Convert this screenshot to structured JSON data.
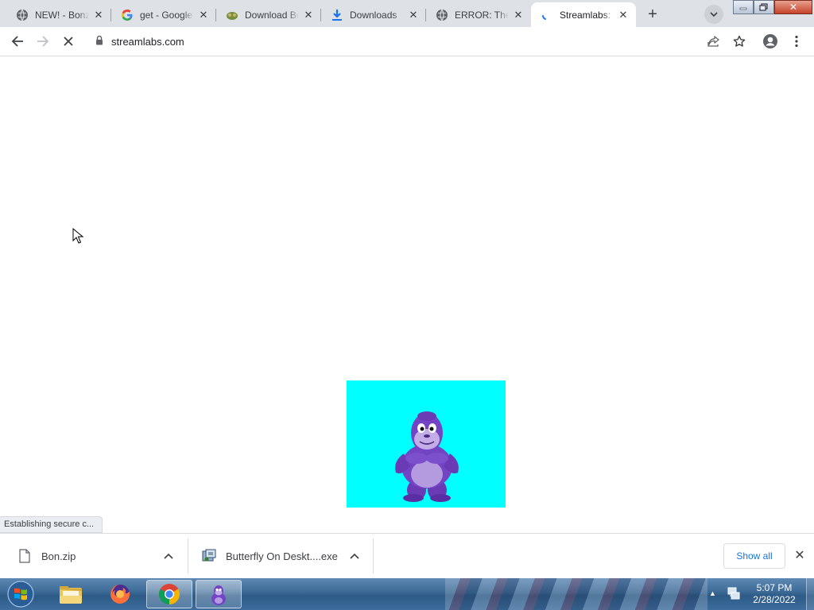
{
  "tabs": [
    {
      "title": "NEW! - Bonzi",
      "favicon": "globe-icon"
    },
    {
      "title": "get - Google Search",
      "favicon": "google-icon"
    },
    {
      "title": "Download BonziBuddy",
      "favicon": "bonzi-favicon-icon"
    },
    {
      "title": "Downloads",
      "favicon": "download-icon"
    },
    {
      "title": "ERROR: The request",
      "favicon": "globe-icon"
    },
    {
      "title": "Streamlabs: Live",
      "favicon": "loading-spinner-icon",
      "active": true
    }
  ],
  "toolbar": {
    "url": "streamlabs.com"
  },
  "page": {
    "status_text": "Establishing secure c...",
    "bonzi_background": "#00ffff"
  },
  "downloads": {
    "items": [
      {
        "name": "Bon.zip",
        "icon": "file-icon"
      },
      {
        "name": "Butterfly On Deskt....exe",
        "icon": "installer-icon"
      }
    ],
    "show_all_label": "Show all"
  },
  "taskbar": {
    "apps": [
      "windows-explorer-icon",
      "firefox-icon",
      "chrome-icon",
      "bonzi-buddy-icon"
    ],
    "active_app": "chrome-icon",
    "time": "5:07 PM",
    "date": "2/28/2022"
  },
  "colors": {
    "tabstrip": "#dee1e6",
    "accent_link": "#1a73e8",
    "taskbar": "#3a6894"
  }
}
